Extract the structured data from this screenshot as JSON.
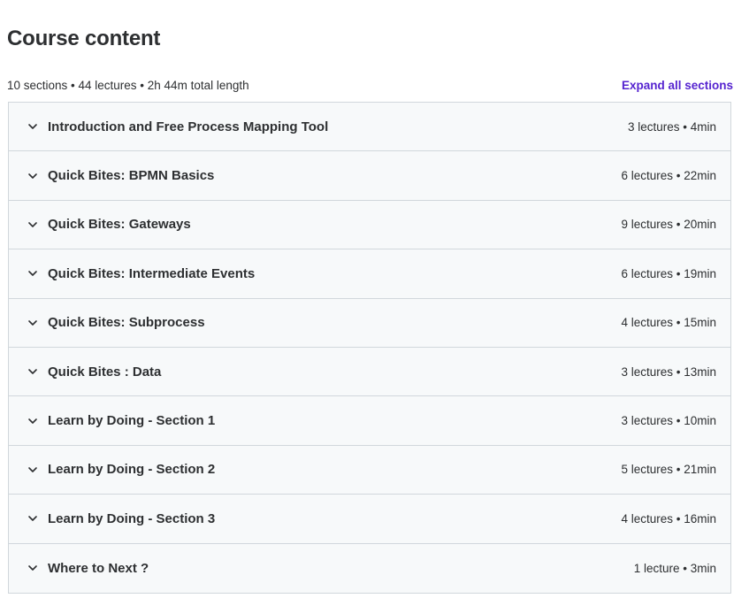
{
  "header": {
    "title": "Course content",
    "summary": "10 sections • 44 lectures • 2h 44m total length",
    "expand_all_label": "Expand all sections"
  },
  "colors": {
    "accent": "#5624d0",
    "section_bg": "#f7f9fa",
    "border": "#d1d7dc",
    "text": "#2d2f31"
  },
  "sections": [
    {
      "title": "Introduction and Free Process Mapping Tool",
      "meta": "3 lectures • 4min",
      "icon": "chevron-down-icon"
    },
    {
      "title": "Quick Bites: BPMN Basics",
      "meta": "6 lectures • 22min",
      "icon": "chevron-down-icon"
    },
    {
      "title": "Quick Bites: Gateways",
      "meta": "9 lectures • 20min",
      "icon": "chevron-down-icon"
    },
    {
      "title": "Quick Bites: Intermediate Events",
      "meta": "6 lectures • 19min",
      "icon": "chevron-down-icon"
    },
    {
      "title": "Quick Bites: Subprocess",
      "meta": "4 lectures • 15min",
      "icon": "chevron-down-icon"
    },
    {
      "title": "Quick Bites : Data",
      "meta": "3 lectures • 13min",
      "icon": "chevron-down-icon"
    },
    {
      "title": "Learn by Doing - Section 1",
      "meta": "3 lectures • 10min",
      "icon": "chevron-down-icon"
    },
    {
      "title": "Learn by Doing - Section 2",
      "meta": "5 lectures • 21min",
      "icon": "chevron-down-icon"
    },
    {
      "title": "Learn by Doing - Section 3",
      "meta": "4 lectures • 16min",
      "icon": "chevron-down-icon"
    },
    {
      "title": "Where to Next ?",
      "meta": "1 lecture • 3min",
      "icon": "chevron-down-icon"
    }
  ]
}
